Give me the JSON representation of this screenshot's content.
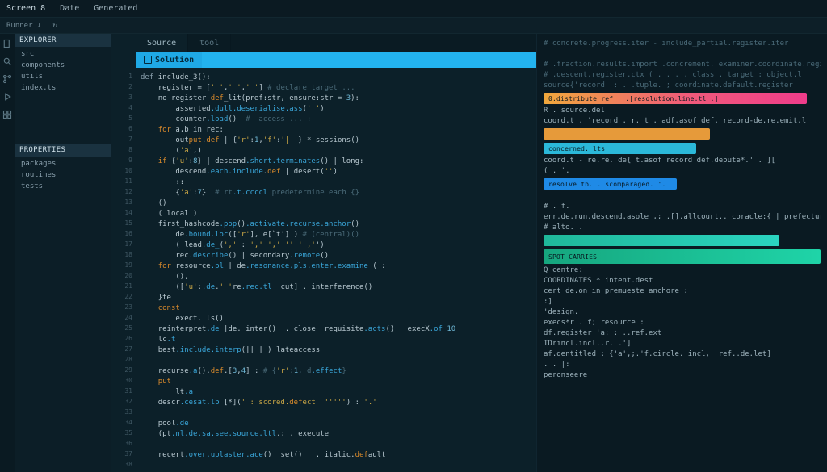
{
  "menubar": {
    "items": [
      "Screen 8",
      "Date",
      "Generated"
    ]
  },
  "toolbar": {
    "items": [
      "Runner ↓",
      "↻"
    ]
  },
  "activity": {
    "icons": [
      "files-icon",
      "search-icon",
      "branch-icon",
      "debug-icon",
      "extensions-icon"
    ]
  },
  "sidebar": {
    "sections": [
      {
        "header": "EXPLORER",
        "items": [
          "src",
          "components",
          "utils",
          "index.ts"
        ]
      },
      {
        "header": "PROPERTIES",
        "items": [
          "packages",
          "routines",
          "tests"
        ]
      }
    ]
  },
  "tabs": {
    "items": [
      {
        "label": "Source",
        "active": true
      },
      {
        "label": "tool",
        "active": false
      }
    ]
  },
  "solution_bar": {
    "label": "Solution"
  },
  "gutter_start": 1,
  "gutter_count": 38,
  "code_lines": [
    {
      "t": "def",
      "kw": true,
      "rest": " include_3():"
    },
    {
      "t": "    ",
      "rest": "register = [' ',' ',' '] # declare target ..."
    },
    {
      "t": "    ",
      "rest": "no register def_lit(pref:str, ensure:str = 3):"
    },
    {
      "t": "        ",
      "rest": "asserted.dull.deserialise.ass(' ')"
    },
    {
      "t": "        ",
      "rest": "counter.load()  #  access ... : "
    },
    {
      "t": "    ",
      "kw": true,
      "t2": "for",
      "rest": " a,b in rec:"
    },
    {
      "t": "        ",
      "rest": "output.def | {'r':1,'f':'| '} * sessions()"
    },
    {
      "t": "        ",
      "rest": "('a',)"
    },
    {
      "t": "    ",
      "kw": true,
      "t2": "if",
      "rest": " {'u':8} | descend.short.terminates() | long:"
    },
    {
      "t": "        ",
      "rest": "descend.each.include.def | desert('')"
    },
    {
      "t": "        ",
      "rest": "::"
    },
    {
      "t": "        ",
      "rest": "{'a':7}  # rt.t.ccccl predetermine each {}"
    },
    {
      "t": "    ",
      "rest": "()"
    },
    {
      "t": "    ",
      "rest": "( local )"
    },
    {
      "t": "    ",
      "rest": "first_hashcode.pop().activate.recurse.anchor()"
    },
    {
      "t": "        ",
      "rest": "de.bound.loc(['r'], e[`t'] ) # (central)()"
    },
    {
      "t": "        ",
      "rest": "( lead.de_(',' : ',' ',' '' ' ,'')"
    },
    {
      "t": "        ",
      "rest": "rec.describe() | secondary.remote()"
    },
    {
      "t": "    ",
      "kw": true,
      "t2": "for",
      "rest": " resource.pl | de.resonance.pls.enter.examine ( :"
    },
    {
      "t": "        ",
      "rest": "(),"
    },
    {
      "t": "        ",
      "rest": "(['u':.de.' 're.rec.tl  cut] . interference()"
    },
    {
      "t": "    ",
      "rest": "}te"
    },
    {
      "t": "    ",
      "kw": true,
      "t2": "const",
      "rest": ""
    },
    {
      "t": "        ",
      "rest": "exect. ls()"
    },
    {
      "t": "    ",
      "rest": "reinterpret.de |de. inter()  . close  requisite.acts() | execX.of 10"
    },
    {
      "t": "    ",
      "rest": "lc.t"
    },
    {
      "t": "    ",
      "rest": "best.include.interp(|| | ) lateaccess"
    },
    {
      "t": "",
      "rest": ""
    },
    {
      "t": "    ",
      "rest": "recurse.a().def.[3,4] : # {'r':1, d.effect}"
    },
    {
      "t": "    ",
      "kw": true,
      "t2": "put",
      "rest": ""
    },
    {
      "t": "        ",
      "rest": "lt.a"
    },
    {
      "t": "    ",
      "rest": "descr.cesat.lb [*](' : scored.defect  ''''') : '.'"
    },
    {
      "t": "",
      "rest": " "
    },
    {
      "t": "    ",
      "rest": "pool.de"
    },
    {
      "t": "    ",
      "rest": "(pt.nl.de.sa.see.source.ltl.; . execute"
    },
    {
      "t": "",
      "rest": " "
    },
    {
      "t": "    ",
      "rest": "recert.over.uplaster.ace()  set()   . italic.default"
    },
    {
      "t": "",
      "rest": ""
    }
  ],
  "right_panel": {
    "top_lines": [
      "# concrete.progress.iter - include_partial.register.iter",
      "",
      "# .fraction.results.import .concrement. examiner.coordinate.register",
      "# .descent.register.ctx ( . . . . class . target : object.l",
      "source{'record' : . .tuple.  ;  coordinate.default.register"
    ],
    "bars": [
      {
        "cls": "grad-pink",
        "label": "0.distribute  ref | .[resolution.line.tl .]"
      }
    ],
    "mid_lines": [
      "R  . source.del",
      "coord.t . 'record . r. t . adf.asof def.   record-de.re.emit.l"
    ],
    "bars2": [
      {
        "cls": "orange",
        "label": ""
      },
      {
        "cls": "cyan",
        "label": "concerned.   lts"
      }
    ],
    "mid_lines2": [
      "coord.t  - re.re.  de{ t.asof record  def.depute*.' . ][",
      "( . '."
    ],
    "bars3": [
      {
        "cls": "blue",
        "label": "resolve tb. .     scomparaged. '."
      }
    ],
    "mid_lines3": [
      " ",
      "  # .  f.",
      "err.de.run.descend.asole ,;  .[].allcourt.. coracle:{ | prefecture  ",
      "      # alto. ."
    ],
    "bars4": [
      {
        "cls": "grad-teal",
        "label": ""
      },
      {
        "cls": "grad-teal2",
        "label": "SPOT CARRIES"
      }
    ],
    "console_lines": [
      "Q   centre:",
      "COORDINATES * intent.dest",
      "cert de.on  in  premueste anchore   :",
      "              :]",
      "'design.",
      "execs*r . f; resource     :",
      "df.register 'a: : ..ref.ext",
      "TDrincl.incl..r.        .']",
      "af.dentitled : {'a',;.'f.circle. incl,' ref..de.let]",
      "  . . |:",
      "peronseere"
    ]
  }
}
